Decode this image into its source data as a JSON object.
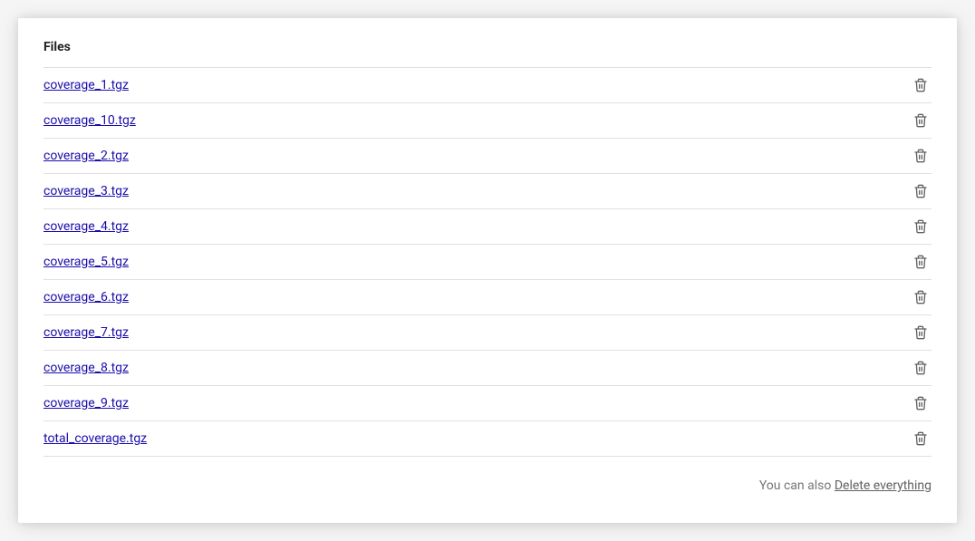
{
  "header": "Files",
  "files": [
    {
      "name": "coverage_1.tgz"
    },
    {
      "name": "coverage_10.tgz"
    },
    {
      "name": "coverage_2.tgz"
    },
    {
      "name": "coverage_3.tgz"
    },
    {
      "name": "coverage_4.tgz"
    },
    {
      "name": "coverage_5.tgz"
    },
    {
      "name": "coverage_6.tgz"
    },
    {
      "name": "coverage_7.tgz"
    },
    {
      "name": "coverage_8.tgz"
    },
    {
      "name": "coverage_9.tgz"
    },
    {
      "name": "total_coverage.tgz"
    }
  ],
  "footer": {
    "prefix": "You can also ",
    "link": "Delete everything"
  }
}
